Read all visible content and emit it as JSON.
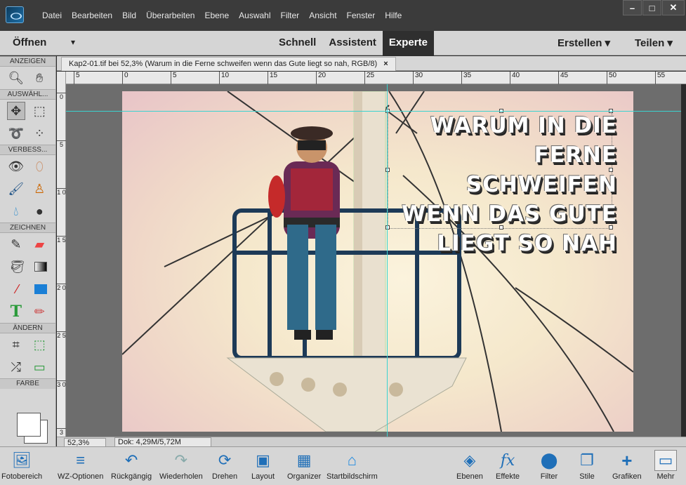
{
  "menubar": {
    "items": [
      "Datei",
      "Bearbeiten",
      "Bild",
      "Überarbeiten",
      "Ebene",
      "Auswahl",
      "Filter",
      "Ansicht",
      "Fenster",
      "Hilfe"
    ]
  },
  "modebar": {
    "open_label": "Öffnen",
    "modes": [
      "Schnell",
      "Assistent",
      "Experte"
    ],
    "active_mode": "Experte",
    "create_label": "Erstellen",
    "share_label": "Teilen"
  },
  "tools": {
    "sections": {
      "view": "ANZEIGEN",
      "select": "AUSWÄHL...",
      "enhance": "VERBESS...",
      "draw": "ZEICHNEN",
      "modify": "ÄNDERN",
      "color": "FARBE"
    }
  },
  "document": {
    "tab_title": "Kap2-01.tif bei 52,3% (Warum in die Ferne schweifen wenn das Gute liegt so nah, RGB/8)",
    "close_glyph": "×",
    "headline_lines": [
      "Warum in die",
      "Ferne schweifen",
      "wenn das Gute",
      "liegt so nah"
    ]
  },
  "rulers": {
    "top_ticks": [
      "5",
      "0",
      "5",
      "10",
      "15",
      "20",
      "25",
      "30",
      "35",
      "40",
      "45",
      "50",
      "55"
    ],
    "left_ticks": [
      "0",
      "5",
      "1 0",
      "1 5",
      "2 0",
      "2 5",
      "3 0",
      "3"
    ]
  },
  "status": {
    "zoom": "52,3%",
    "doc_size": "Dok: 4,29M/5,72M"
  },
  "bottombar": {
    "left_buttons": [
      "Fotobereich",
      "WZ-Optionen",
      "Rückgängig",
      "Wiederholen",
      "Drehen",
      "Layout",
      "Organizer",
      "Startbildschirm"
    ],
    "right_buttons": [
      "Ebenen",
      "Effekte",
      "Filter",
      "Stile",
      "Grafiken",
      "Mehr"
    ]
  },
  "colors": {
    "guide": "#3ad3d0",
    "menubar_bg": "#3b3b3b",
    "panel_bg": "#d6d6d6",
    "active_mode_bg": "#2f2f2f"
  }
}
